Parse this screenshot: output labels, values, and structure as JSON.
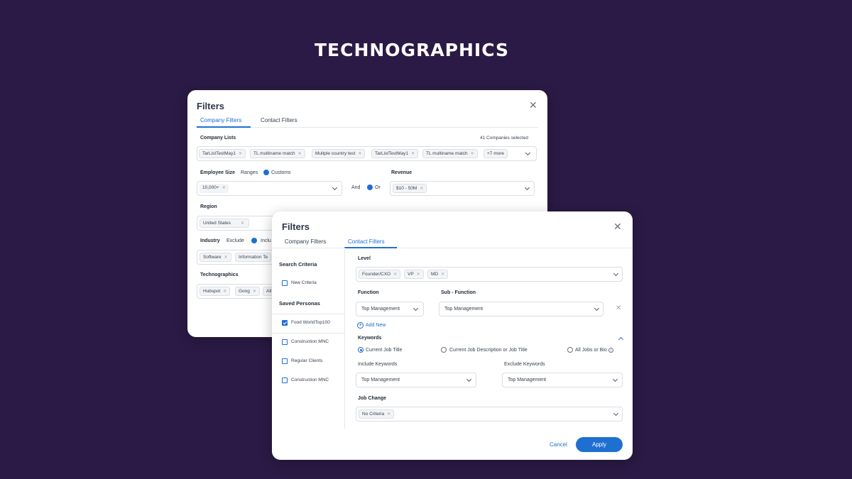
{
  "headline": "TECHNOGRAPHICS",
  "colors": {
    "background": "#2a1a45",
    "accent": "#1f6fd1"
  },
  "back_panel": {
    "title": "Filters",
    "close_icon": "close-icon",
    "tabs": [
      {
        "label": "Company Filters",
        "active": true
      },
      {
        "label": "Contact Filters",
        "active": false
      }
    ],
    "company_lists": {
      "label": "Company Lists",
      "selected_count": "41 Companies selected",
      "chips": [
        "TarListTestMay1",
        "TL multiname match",
        "Multple country test",
        "TarListTestMay1",
        "TL multiname match"
      ],
      "more": "+7 more"
    },
    "employee_size": {
      "label": "Employee Size",
      "option_ranges": "Ranges",
      "option_customs": "Customs",
      "chip": "10,000+"
    },
    "logic": {
      "and": "And",
      "or": "Or"
    },
    "revenue": {
      "label": "Revenue",
      "chip": "$10 - 50M"
    },
    "region": {
      "label": "Region",
      "chip": "United States"
    },
    "industry": {
      "label": "Industry",
      "option_exclude": "Exclude",
      "option_include": "Inclu",
      "chips": [
        "Software",
        "Information Te"
      ]
    },
    "technographics": {
      "label": "Technographics",
      "chips": [
        "Hubspot",
        "Gong",
        "All"
      ]
    }
  },
  "front_panel": {
    "title": "Filters",
    "close_icon": "close-icon",
    "tabs": [
      {
        "label": "Company Filters",
        "active": false
      },
      {
        "label": "Contact Filters",
        "active": true
      }
    ],
    "sidebar": {
      "search_criteria": "Search Criteria",
      "new_criteria": "New Criteria",
      "saved_personas": "Saved Personas",
      "personas": [
        {
          "label": "Food WorldTop100",
          "checked": true
        },
        {
          "label": "Construction MNC",
          "checked": false
        },
        {
          "label": "Regular Clients",
          "checked": false
        },
        {
          "label": "Construction MNC",
          "checked": false
        }
      ]
    },
    "level": {
      "label": "Level",
      "chips": [
        "Founder/CXO",
        "VP",
        "MD"
      ]
    },
    "function": {
      "label": "Function",
      "value": "Top Management"
    },
    "sub_function": {
      "label": "Sub - Function",
      "value": "Top Management"
    },
    "add_new": "Add New",
    "keywords": {
      "label": "Keywords",
      "options": [
        "Current Job Title",
        "Current Job Description or Job Title",
        "All Jobs or Bio"
      ],
      "include_label": "Include Keywords",
      "include_value": "Top Management",
      "exclude_label": "Exclude Keywords",
      "exclude_value": "Top Management"
    },
    "job_change": {
      "label": "Job Change",
      "chip": "No Criteria"
    },
    "cancel": "Cancel",
    "apply": "Apply"
  }
}
